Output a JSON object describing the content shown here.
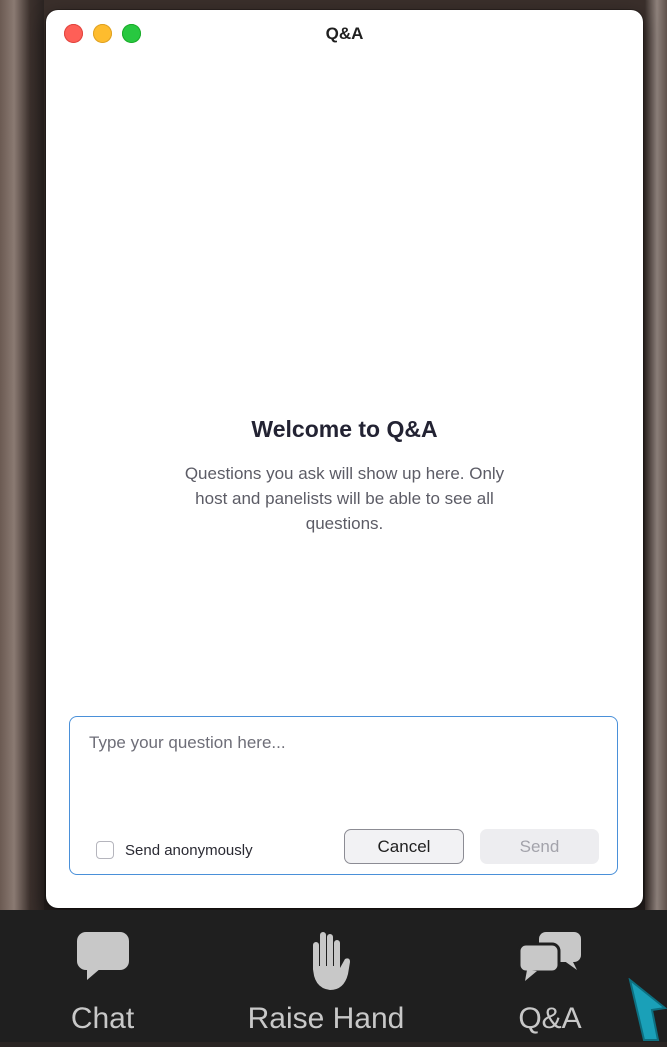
{
  "window": {
    "title": "Q&A"
  },
  "welcome": {
    "heading": "Welcome to Q&A",
    "body": "Questions you ask will show up here. Only host and panelists will be able to see all questions."
  },
  "composer": {
    "placeholder": "Type your question here...",
    "value": "",
    "anonymous_label": "Send anonymously",
    "anonymous_checked": false,
    "cancel_label": "Cancel",
    "send_label": "Send"
  },
  "toolbar": {
    "items": [
      {
        "label": "Chat",
        "icon": "chat-bubble-icon"
      },
      {
        "label": "Raise Hand",
        "icon": "raise-hand-icon"
      },
      {
        "label": "Q&A",
        "icon": "qa-bubbles-icon"
      }
    ]
  },
  "colors": {
    "accent_border": "#4a90d9",
    "traffic_close": "#fe5f57",
    "traffic_minimize": "#febc2e",
    "traffic_maximize": "#28c840",
    "toolbar_bg": "#1f1f1f",
    "toolbar_icon": "#c8c8c8",
    "cursor": "#1aa0b8"
  }
}
